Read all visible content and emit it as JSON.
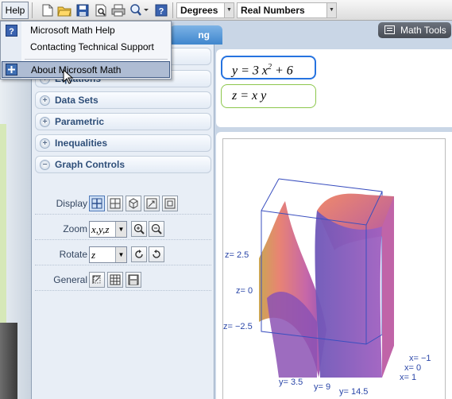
{
  "menubar": {
    "help": "Help"
  },
  "help_menu": {
    "items": [
      {
        "label": "Microsoft Math Help"
      },
      {
        "label": "Contacting Technical Support"
      },
      {
        "label": "About Microsoft Math"
      }
    ]
  },
  "toolbar": {
    "angle_unit": "Degrees",
    "number_set": "Real Numbers",
    "icons": [
      "new-icon",
      "open-folder-icon",
      "save-icon",
      "print-preview-icon",
      "print-icon",
      "zoom-icon",
      "help-icon"
    ]
  },
  "tabs": {
    "graphing_visible": "ng"
  },
  "math_tools": {
    "label": "Math Tools"
  },
  "sections": {
    "equations_partial": "Equations",
    "data_sets": "Data Sets",
    "parametric": "Parametric",
    "inequalities": "Inequalities",
    "graph_controls": "Graph Controls"
  },
  "graph_controls": {
    "display_label": "Display",
    "zoom_label": "Zoom",
    "zoom_axes": "x,y,z",
    "rotate_label": "Rotate",
    "rotate_axis": "z",
    "general_label": "General"
  },
  "equations": [
    {
      "text": "y = 3 x",
      "sup": "2",
      "tail": " + 6"
    },
    {
      "text": "z = x y"
    }
  ],
  "graph": {
    "z_labels": [
      "z= 2.5",
      "z= 0",
      "z= −2.5"
    ],
    "y_labels": [
      "y= 3.5",
      "y= 9",
      "y= 14.5"
    ],
    "x_labels": [
      "x= −1",
      "x= 0",
      "x= 1"
    ],
    "colors": {
      "surface_warm": "#e9826a",
      "surface_cool": "#9b4fb0",
      "box": "#3a4fbf"
    }
  }
}
